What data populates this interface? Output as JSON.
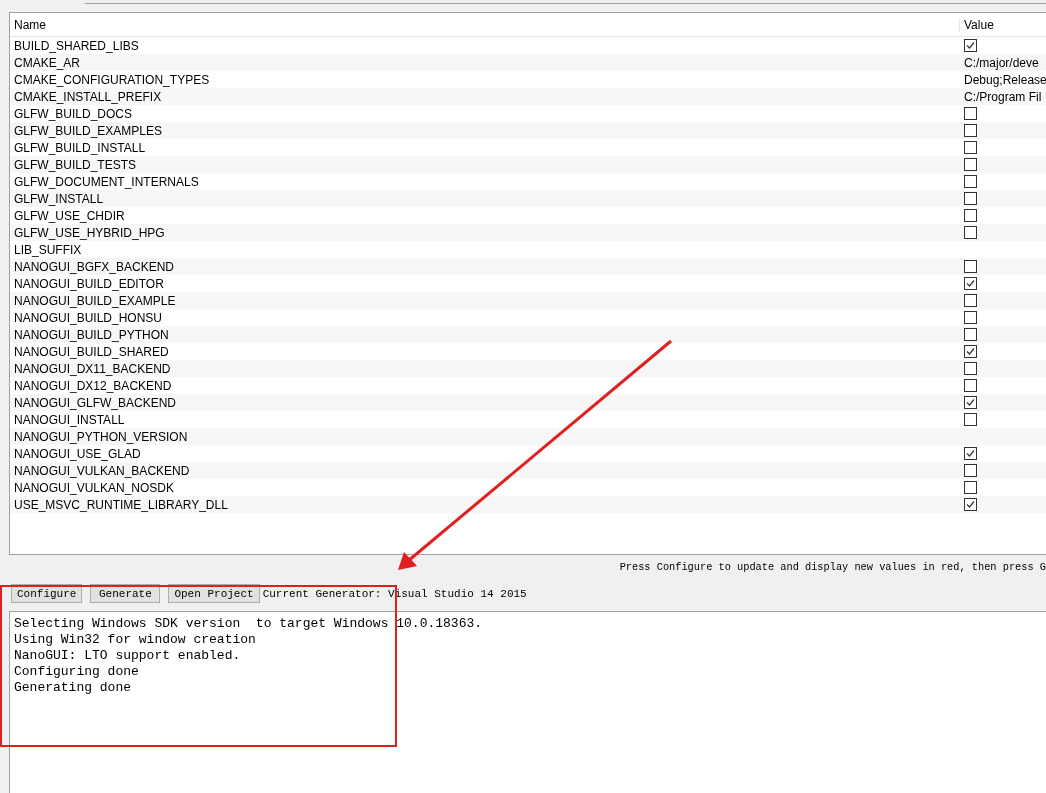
{
  "table": {
    "columns": [
      "Name",
      "Value"
    ],
    "rows": [
      {
        "name": "BUILD_SHARED_LIBS",
        "kind": "bool",
        "checked": true
      },
      {
        "name": "CMAKE_AR",
        "kind": "text",
        "value": "C:/major/deve"
      },
      {
        "name": "CMAKE_CONFIGURATION_TYPES",
        "kind": "text",
        "value": "Debug;Release"
      },
      {
        "name": "CMAKE_INSTALL_PREFIX",
        "kind": "text",
        "value": "C:/Program Fil"
      },
      {
        "name": "GLFW_BUILD_DOCS",
        "kind": "bool",
        "checked": false
      },
      {
        "name": "GLFW_BUILD_EXAMPLES",
        "kind": "bool",
        "checked": false
      },
      {
        "name": "GLFW_BUILD_INSTALL",
        "kind": "bool",
        "checked": false
      },
      {
        "name": "GLFW_BUILD_TESTS",
        "kind": "bool",
        "checked": false
      },
      {
        "name": "GLFW_DOCUMENT_INTERNALS",
        "kind": "bool",
        "checked": false
      },
      {
        "name": "GLFW_INSTALL",
        "kind": "bool",
        "checked": false
      },
      {
        "name": "GLFW_USE_CHDIR",
        "kind": "bool",
        "checked": false
      },
      {
        "name": "GLFW_USE_HYBRID_HPG",
        "kind": "bool",
        "checked": false
      },
      {
        "name": "LIB_SUFFIX",
        "kind": "text"
      },
      {
        "name": "NANOGUI_BGFX_BACKEND",
        "kind": "bool",
        "checked": false
      },
      {
        "name": "NANOGUI_BUILD_EDITOR",
        "kind": "bool",
        "checked": true
      },
      {
        "name": "NANOGUI_BUILD_EXAMPLE",
        "kind": "bool",
        "checked": false
      },
      {
        "name": "NANOGUI_BUILD_HONSU",
        "kind": "bool",
        "checked": false
      },
      {
        "name": "NANOGUI_BUILD_PYTHON",
        "kind": "bool",
        "checked": false
      },
      {
        "name": "NANOGUI_BUILD_SHARED",
        "kind": "bool",
        "checked": true
      },
      {
        "name": "NANOGUI_DX11_BACKEND",
        "kind": "bool",
        "checked": false
      },
      {
        "name": "NANOGUI_DX12_BACKEND",
        "kind": "bool",
        "checked": false
      },
      {
        "name": "NANOGUI_GLFW_BACKEND",
        "kind": "bool",
        "checked": true
      },
      {
        "name": "NANOGUI_INSTALL",
        "kind": "bool",
        "checked": false
      },
      {
        "name": "NANOGUI_PYTHON_VERSION",
        "kind": "text"
      },
      {
        "name": "NANOGUI_USE_GLAD",
        "kind": "bool",
        "checked": true
      },
      {
        "name": "NANOGUI_VULKAN_BACKEND",
        "kind": "bool",
        "checked": false
      },
      {
        "name": "NANOGUI_VULKAN_NOSDK",
        "kind": "bool",
        "checked": false
      },
      {
        "name": "USE_MSVC_RUNTIME_LIBRARY_DLL",
        "kind": "bool",
        "checked": true
      }
    ]
  },
  "hint": "Press Configure to update and display new values in red, then press G",
  "buttons": [
    "Configure",
    "Generate",
    "Open Project"
  ],
  "generator": "Current Generator: Visual Studio 14 2015",
  "output": [
    "Selecting Windows SDK version  to target Windows 10.0.18363.",
    "Using Win32 for window creation",
    "NanoGUI: LTO support enabled.",
    "Configuring done",
    "Generating done"
  ]
}
